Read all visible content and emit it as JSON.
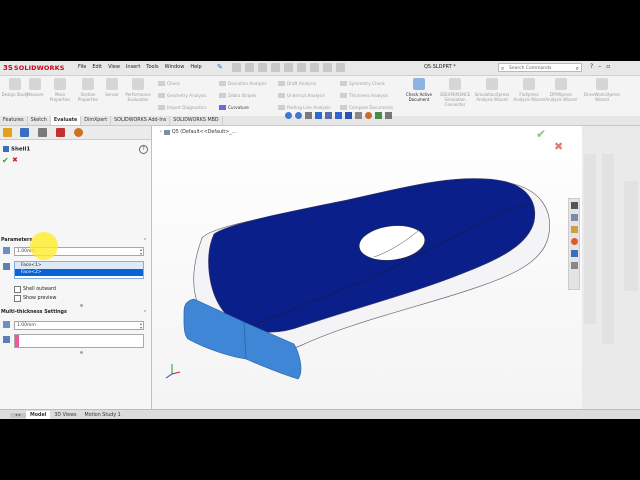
{
  "app": {
    "brand_logo": "SOLIDWORKS",
    "brand_mark": "3S",
    "document_title": "Q5.SLDPRT *"
  },
  "menus": [
    "File",
    "Edit",
    "View",
    "Insert",
    "Tools",
    "Window",
    "Help"
  ],
  "search": {
    "placeholder": "Search Commands"
  },
  "ribbon": {
    "large": [
      {
        "label": "Design Study",
        "active": false
      },
      {
        "label": "Measure",
        "active": false
      },
      {
        "label": "Mass Properties",
        "active": false
      },
      {
        "label": "Section Properties",
        "active": false
      },
      {
        "label": "Sensor",
        "active": false
      },
      {
        "label": "Performance Evaluation",
        "active": false
      },
      {
        "label": "Check Active Document",
        "active": true
      },
      {
        "label": "3DEXPERIENCE Simulation Connector",
        "active": false
      },
      {
        "label": "SimulationXpress Analysis Wizard",
        "active": false
      },
      {
        "label": "FloXpress Analysis Wizard",
        "active": false
      },
      {
        "label": "DFMXpress Analysis Wizard",
        "active": false
      },
      {
        "label": "DriveWorksXpress Wizard",
        "active": false
      }
    ],
    "small": [
      {
        "label": "Check",
        "active": false
      },
      {
        "label": "Geometry Analysis",
        "active": false
      },
      {
        "label": "Import Diagnostics",
        "active": false
      },
      {
        "label": "Deviation Analysis",
        "active": false
      },
      {
        "label": "Zebra Stripes",
        "active": false
      },
      {
        "label": "Curvature",
        "active": true
      },
      {
        "label": "Draft Analysis",
        "active": false
      },
      {
        "label": "Undercut Analysis",
        "active": false
      },
      {
        "label": "Parting Line Analysis",
        "active": false
      },
      {
        "label": "Symmetry Check",
        "active": false
      },
      {
        "label": "Thickness Analysis",
        "active": false
      },
      {
        "label": "Compare Documents",
        "active": false
      }
    ]
  },
  "tabs": [
    "Features",
    "Sketch",
    "Evaluate",
    "DimXpert",
    "SOLIDWORKS Add-Ins",
    "SOLIDWORKS MBD"
  ],
  "selected_tab": "Evaluate",
  "property_manager": {
    "title": "Shell1",
    "parameters_header": "Parameters",
    "thickness_value": "1.00mm",
    "faces": [
      "Face<1>",
      "Face<2>"
    ],
    "shell_outward": "Shell outward",
    "show_preview": "Show preview",
    "multi_header": "Multi-thickness Settings",
    "multi_thickness_value": "1.00mm"
  },
  "tree": {
    "label": "Q5  (Default<<Default>_..."
  },
  "bottom_tabs": [
    "Model",
    "3D Views",
    "Motion Study 1"
  ],
  "selected_bottom_tab": "Model",
  "colors": {
    "face_blue": "#0a1f8a",
    "highlight_blue": "#3f86d6",
    "selection": "#0a64d6",
    "brand_red": "#d0021b"
  }
}
